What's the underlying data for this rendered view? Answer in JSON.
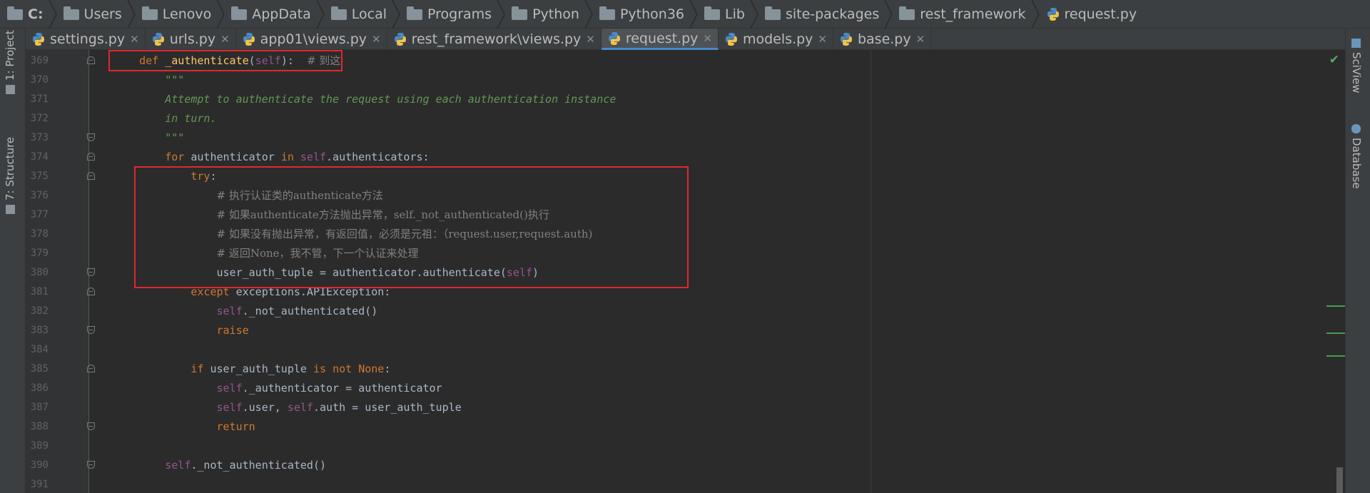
{
  "breadcrumb": [
    "C:",
    "Users",
    "Lenovo",
    "AppData",
    "Local",
    "Programs",
    "Python",
    "Python36",
    "Lib",
    "site-packages",
    "rest_framework",
    "request.py"
  ],
  "tabs": [
    {
      "label": "settings.py",
      "active": false
    },
    {
      "label": "urls.py",
      "active": false
    },
    {
      "label": "app01\\views.py",
      "active": false
    },
    {
      "label": "rest_framework\\views.py",
      "active": false
    },
    {
      "label": "request.py",
      "active": true
    },
    {
      "label": "models.py",
      "active": false
    },
    {
      "label": "base.py",
      "active": false
    }
  ],
  "left_tools": [
    "1: Project",
    "7: Structure"
  ],
  "right_tools": [
    "SciView",
    "Database"
  ],
  "code": {
    "lines": [
      {
        "no": "369",
        "t": "    def _authenticate(self):  # 到这"
      },
      {
        "no": "370",
        "t": "        \"\"\""
      },
      {
        "no": "371",
        "t": "        Attempt to authenticate the request using each authentication instance"
      },
      {
        "no": "372",
        "t": "        in turn."
      },
      {
        "no": "373",
        "t": "        \"\"\""
      },
      {
        "no": "374",
        "t": "        for authenticator in self.authenticators:"
      },
      {
        "no": "375",
        "t": "            try:"
      },
      {
        "no": "376",
        "t": "                # 执行认证类的authenticate方法"
      },
      {
        "no": "377",
        "t": "                # 如果authenticate方法抛出异常，self._not_authenticated()执行"
      },
      {
        "no": "378",
        "t": "                # 如果没有抛出异常，有返回值，必须是元祖：（request.user,request.auth)"
      },
      {
        "no": "379",
        "t": "                # 返回None，我不管，下一个认证来处理"
      },
      {
        "no": "380",
        "t": "                user_auth_tuple = authenticator.authenticate(self)"
      },
      {
        "no": "381",
        "t": "            except exceptions.APIException:"
      },
      {
        "no": "382",
        "t": "                self._not_authenticated()"
      },
      {
        "no": "383",
        "t": "                raise"
      },
      {
        "no": "384",
        "t": ""
      },
      {
        "no": "385",
        "t": "            if user_auth_tuple is not None:"
      },
      {
        "no": "386",
        "t": "                self._authenticator = authenticator"
      },
      {
        "no": "387",
        "t": "                self.user, self.auth = user_auth_tuple"
      },
      {
        "no": "388",
        "t": "                return"
      },
      {
        "no": "389",
        "t": ""
      },
      {
        "no": "390",
        "t": "        self._not_authenticated()"
      },
      {
        "no": "391",
        "t": ""
      }
    ]
  },
  "colors": {
    "keyword": "#cc7832",
    "self": "#94558d",
    "function": "#ffc66d",
    "docstring": "#629755",
    "comment": "#808080",
    "text": "#a9b7c6",
    "highlight_box": "#e0282e"
  }
}
